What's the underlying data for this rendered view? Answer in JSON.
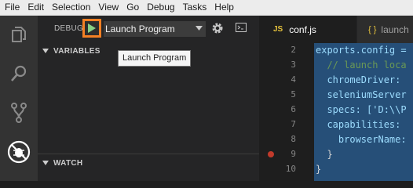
{
  "menu": [
    "File",
    "Edit",
    "Selection",
    "View",
    "Go",
    "Debug",
    "Tasks",
    "Help"
  ],
  "debug": {
    "title": "DEBUG",
    "config": "Launch Program",
    "tooltip": "Launch Program"
  },
  "sections": {
    "variables": "VARIABLES",
    "watch": "WATCH"
  },
  "tabs": [
    {
      "badge": "JS",
      "label": "conf.js"
    },
    {
      "badge": "{ }",
      "label": "launch"
    }
  ],
  "editor": {
    "line_numbers": [
      "2",
      "3",
      "4",
      "5",
      "6",
      "7",
      "8",
      "9",
      "10"
    ],
    "breakpoint_line": "9",
    "lines": [
      {
        "a": "exports.config = "
      },
      {
        "a": "  // launch loca"
      },
      {
        "a": "  chromeDriver: "
      },
      {
        "a": "  seleniumServer"
      },
      {
        "a": "  specs: ['D:\\\\P"
      },
      {
        "a": "  capabilities: "
      },
      {
        "a": "    browserName:"
      },
      {
        "a": "  }"
      },
      {
        "a": "}"
      }
    ]
  },
  "colors": {
    "accent_highlight": "#f48024",
    "play_green": "#89d185",
    "selection": "#264f78"
  }
}
